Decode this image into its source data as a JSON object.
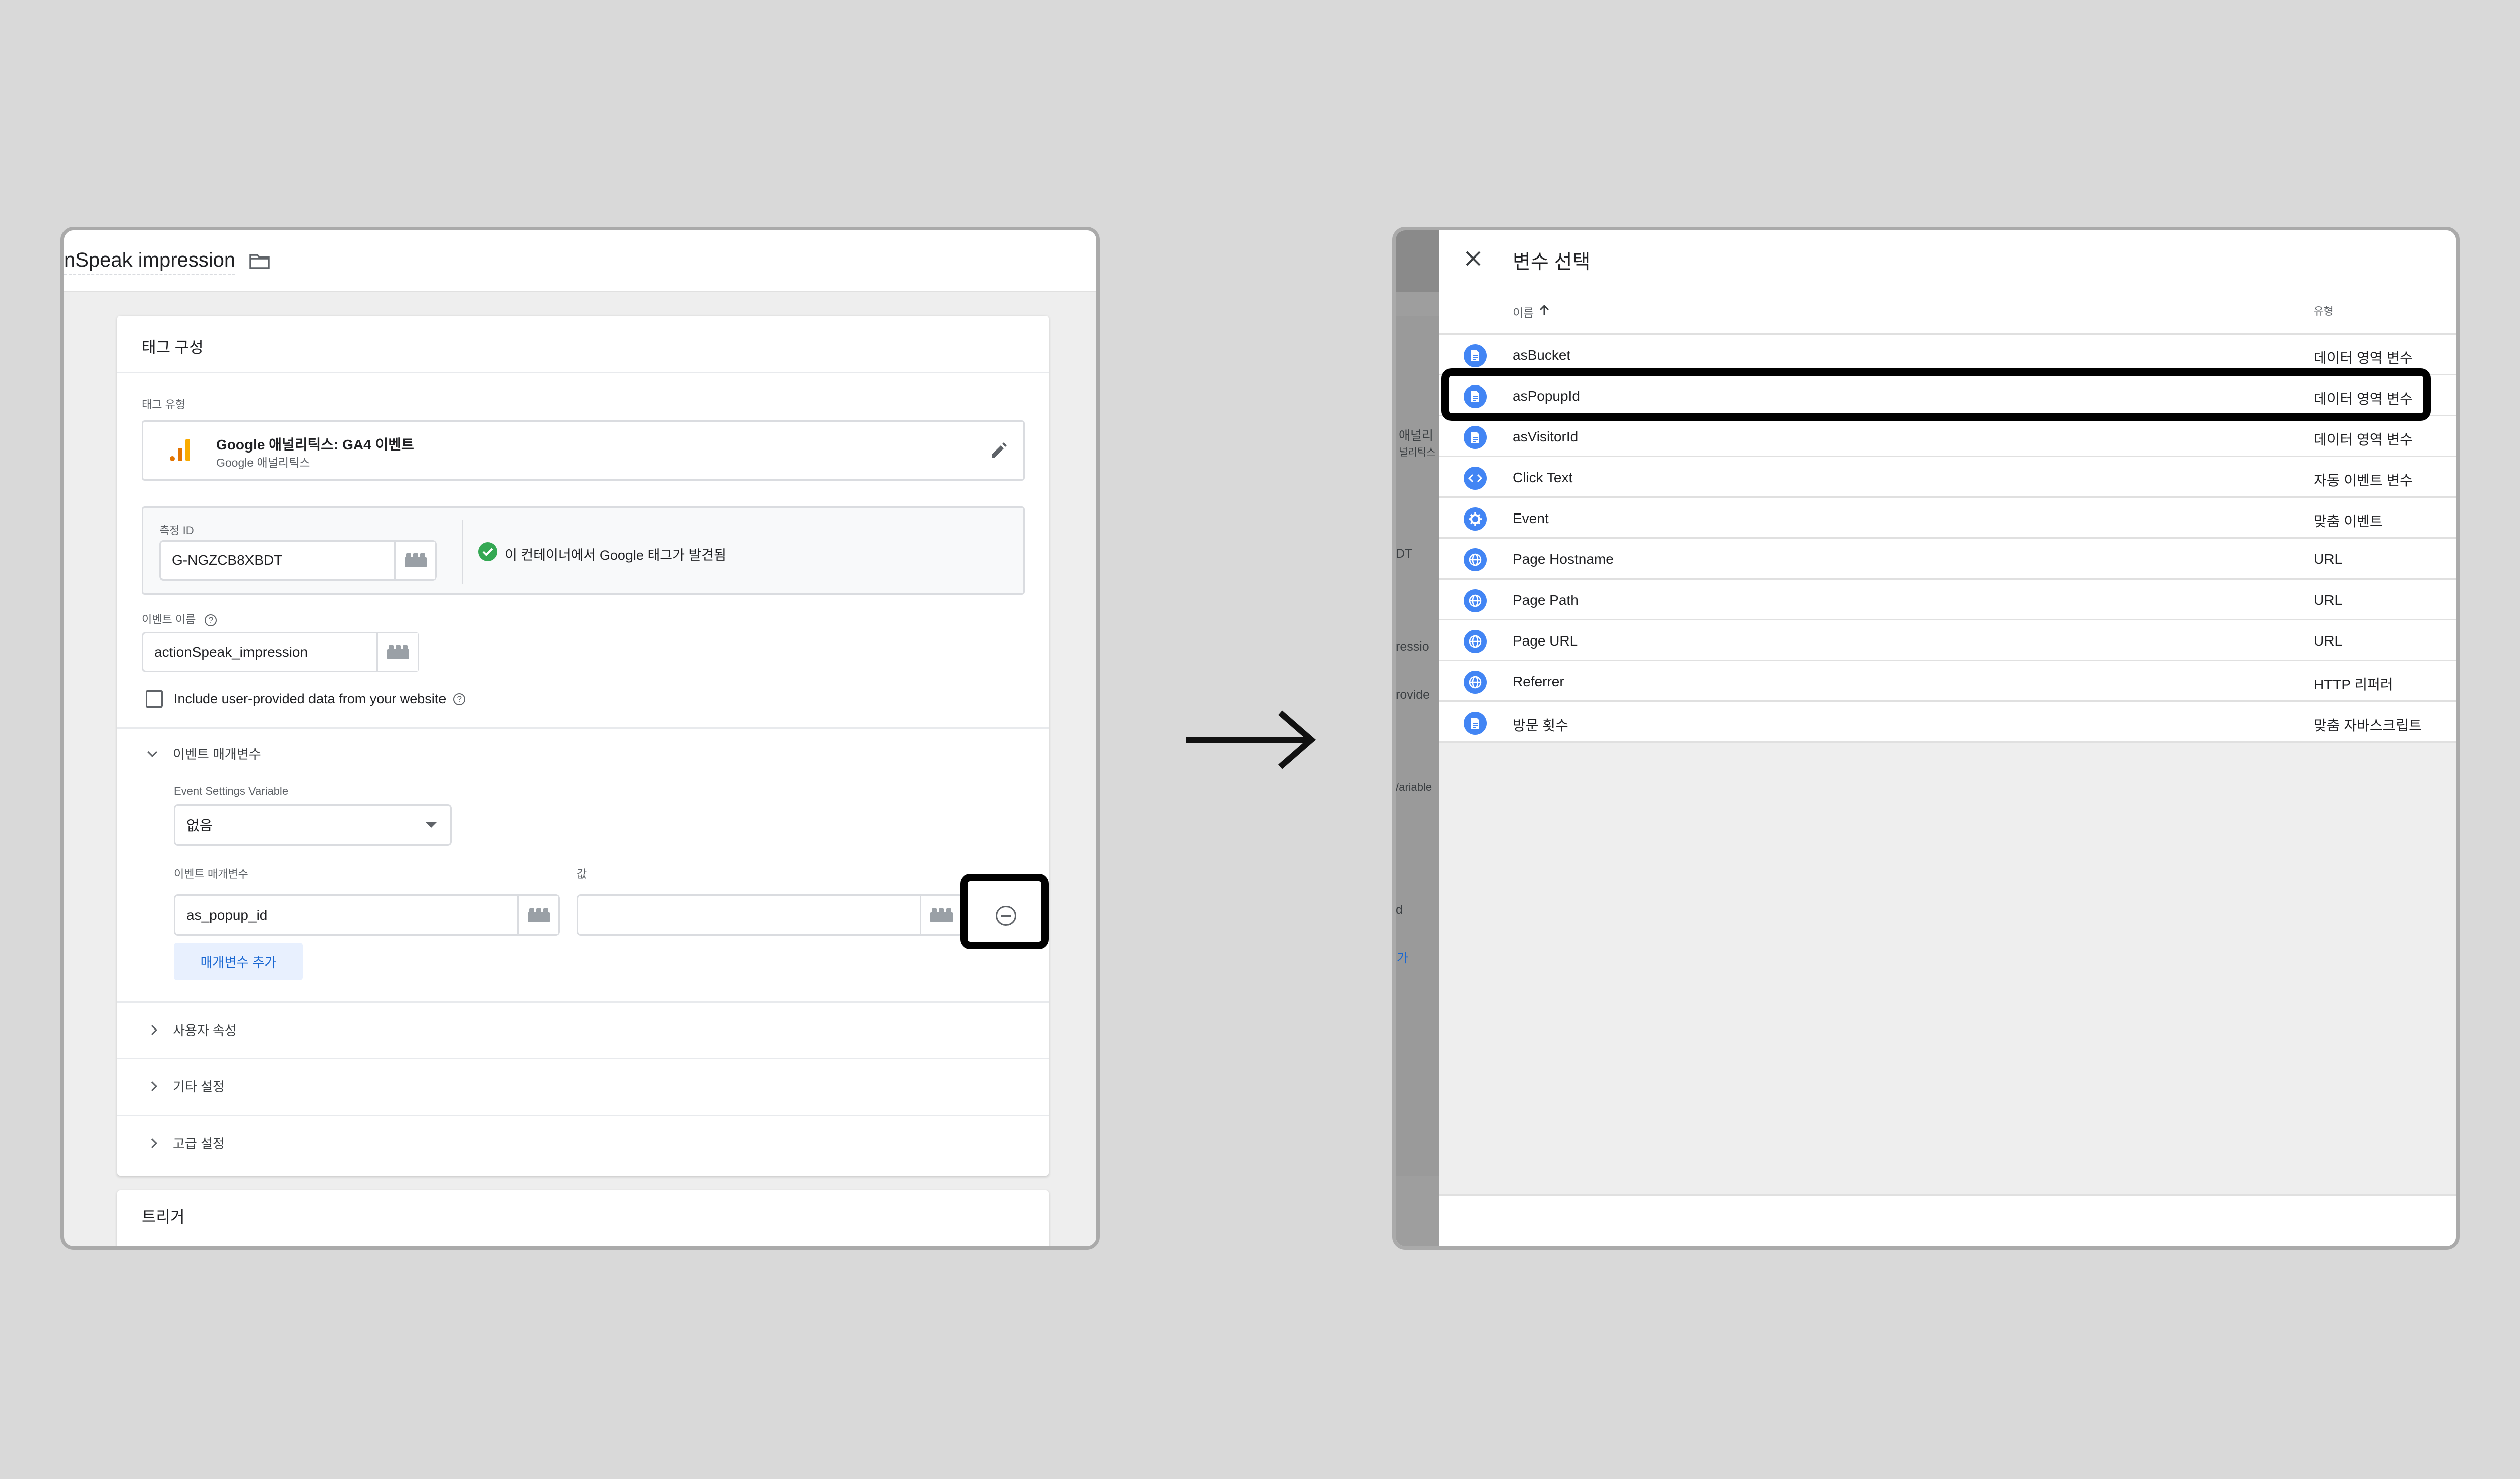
{
  "left_panel": {
    "tag_title": "nSpeak impression",
    "card_title": "태그 구성",
    "tag_type_label": "태그 유형",
    "tag_type_name": "Google 애널리틱스: GA4 이벤트",
    "tag_type_sub": "Google 애널리틱스",
    "measurement_id_label": "측정 ID",
    "measurement_id_value": "G-NGZCB8XBDT",
    "google_tag_found": "이 컨테이너에서 Google 태그가 발견됨",
    "event_name_label": "이벤트 이름",
    "event_name_value": "actionSpeak_impression",
    "include_user_data_label": "Include user-provided data from your website",
    "event_params_section": "이벤트 매개변수",
    "event_settings_variable_label": "Event Settings Variable",
    "event_settings_variable_value": "없음",
    "event_param_col_label": "이벤트 매개변수",
    "value_col_label": "값",
    "event_param_value": "as_popup_id",
    "value_field_value": "",
    "add_param_button": "매개변수 추가",
    "user_props_section": "사용자 속성",
    "other_settings_section": "기타 설정",
    "advanced_settings_section": "고급 설정",
    "trigger_title": "트리거"
  },
  "right_panel": {
    "dialog_title": "변수 선택",
    "col_name": "이름",
    "col_type": "유형",
    "variables": [
      {
        "name": "asBucket",
        "type": "데이터 영역 변수",
        "icon": "document-icon"
      },
      {
        "name": "asPopupId",
        "type": "데이터 영역 변수",
        "icon": "document-icon"
      },
      {
        "name": "asVisitorId",
        "type": "데이터 영역 변수",
        "icon": "document-icon"
      },
      {
        "name": "Click Text",
        "type": "자동 이벤트 변수",
        "icon": "code-icon"
      },
      {
        "name": "Event",
        "type": "맞춤 이벤트",
        "icon": "gear-icon"
      },
      {
        "name": "Page Hostname",
        "type": "URL",
        "icon": "globe-icon"
      },
      {
        "name": "Page Path",
        "type": "URL",
        "icon": "globe-icon"
      },
      {
        "name": "Page URL",
        "type": "URL",
        "icon": "globe-icon"
      },
      {
        "name": "Referrer",
        "type": "HTTP 리퍼러",
        "icon": "globe-icon"
      },
      {
        "name": "방문 횟수",
        "type": "맞춤 자바스크립트",
        "icon": "document-icon"
      }
    ],
    "peek_texts": [
      "애널리",
      "널리틱스",
      "DT",
      "ressio",
      "rovide",
      "/ariable",
      "d",
      "가"
    ]
  },
  "colors": {
    "accent": "#4285f4",
    "highlight": "#000000",
    "check": "#34a853",
    "bg": "#d9d9d9"
  }
}
